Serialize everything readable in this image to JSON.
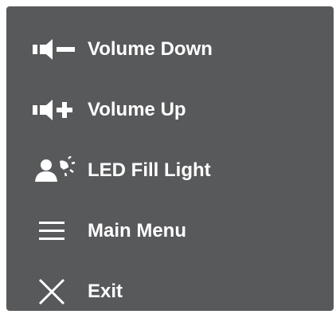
{
  "menu": {
    "items": [
      {
        "label": "Volume Down",
        "icon": "volume-down-icon"
      },
      {
        "label": "Volume Up",
        "icon": "volume-up-icon"
      },
      {
        "label": "LED Fill Light",
        "icon": "led-fill-light-icon"
      },
      {
        "label": "Main Menu",
        "icon": "hamburger-menu-icon"
      },
      {
        "label": "Exit",
        "icon": "close-icon"
      }
    ]
  },
  "colors": {
    "panel_background": "#58595b",
    "text": "#ffffff",
    "icon": "#ffffff"
  }
}
